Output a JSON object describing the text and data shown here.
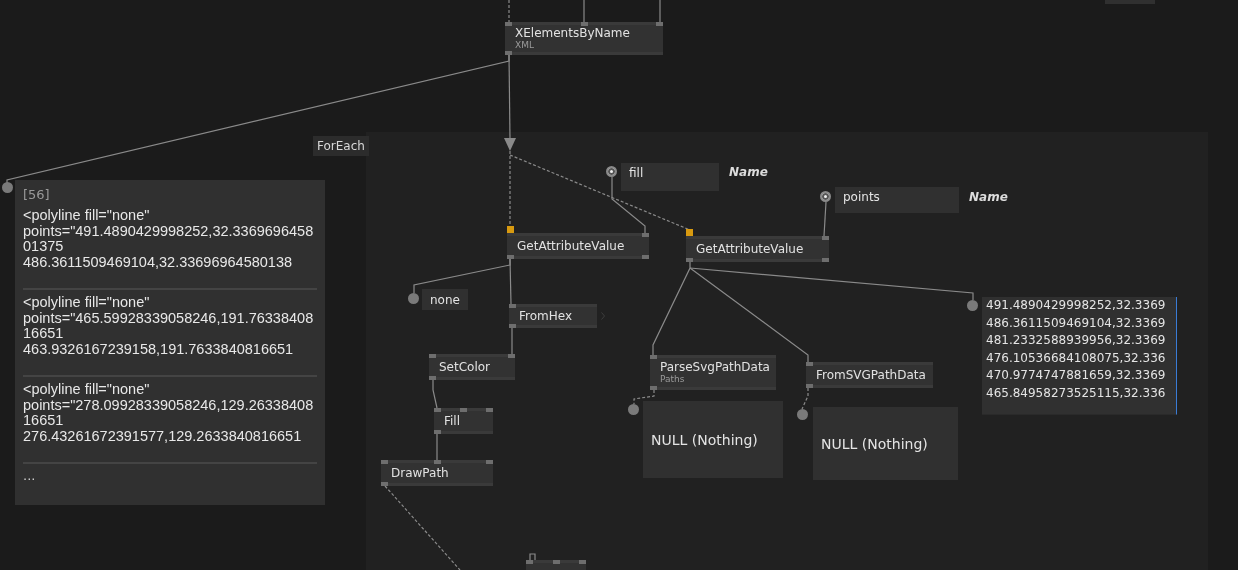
{
  "region": {
    "title": "ForEach"
  },
  "nodes": [
    {
      "title": "XElementsByName",
      "subtitle": "XML",
      "inputs": [
        {
          "active": false
        },
        {
          "active": false
        },
        {
          "active": false
        }
      ],
      "outputs": [
        {
          "active": false
        }
      ]
    },
    {
      "title": "GetAttributeValue",
      "inputs": [
        {
          "active": true
        },
        {
          "active": false
        }
      ],
      "outputs": [
        {
          "active": false
        },
        {
          "active": false
        }
      ]
    },
    {
      "title": "GetAttributeValue",
      "inputs": [
        {
          "active": true
        },
        {
          "active": false
        }
      ],
      "outputs": [
        {
          "active": false
        },
        {
          "active": false
        }
      ]
    },
    {
      "title": "FromHex",
      "inputs": [
        {
          "active": false
        }
      ],
      "outputs": [
        {
          "active": false
        }
      ]
    },
    {
      "title": "SetColor",
      "inputs": [
        {
          "active": false
        },
        {
          "active": false
        }
      ],
      "outputs": [
        {
          "active": false
        }
      ]
    },
    {
      "title": "Fill",
      "inputs": [
        {
          "active": false
        },
        {
          "active": false
        },
        {
          "active": false
        }
      ],
      "outputs": [
        {
          "active": false
        }
      ]
    },
    {
      "title": "DrawPath",
      "inputs": [
        {
          "active": false
        },
        {
          "active": false
        },
        {
          "active": false
        }
      ],
      "outputs": [
        {
          "active": false
        }
      ]
    },
    {
      "title": "ParseSvgPathData",
      "subtitle": "Paths",
      "inputs": [
        {
          "active": false
        }
      ],
      "outputs": [
        {
          "active": false
        }
      ]
    },
    {
      "title": "FromSVGPathData",
      "inputs": [
        {
          "active": false
        }
      ],
      "outputs": [
        {
          "active": false
        }
      ]
    },
    {
      "inputs": [
        {
          "active": false
        },
        {
          "active": false
        },
        {
          "active": false
        }
      ]
    }
  ],
  "ioboxes": [
    {
      "kind": "string",
      "value": "fill",
      "label": "Name"
    },
    {
      "kind": "string",
      "value": "points",
      "label": "Name"
    },
    {
      "kind": "value",
      "value": "none"
    },
    {
      "kind": "value",
      "value": "NULL (Nothing)"
    },
    {
      "kind": "value",
      "value": "NULL (Nothing)"
    },
    {
      "kind": "lines",
      "lines": [
        "491.4890429998252,32.3369",
        "486.3611509469104,32.3369",
        "481.2332588939956,32.3369",
        "476.10536684108075,32.336",
        "470.9774747881659,32.3369",
        "465.84958273525115,32.336"
      ]
    }
  ],
  "spread": {
    "count": "[56]",
    "items": [
      "<polyline fill=\"none\"\npoints=\"491.4890429998252,32.336969645801375\n486.3611509469104,32.33696964580138",
      "<polyline fill=\"none\"\npoints=\"465.59928339058246,191.7633840816651\n463.9326167239158,191.7633840816651",
      "<polyline fill=\"none\"\npoints=\"278.09928339058246,129.2633840816651\n276.43261672391577,129.2633840816651"
    ],
    "more": "..."
  }
}
